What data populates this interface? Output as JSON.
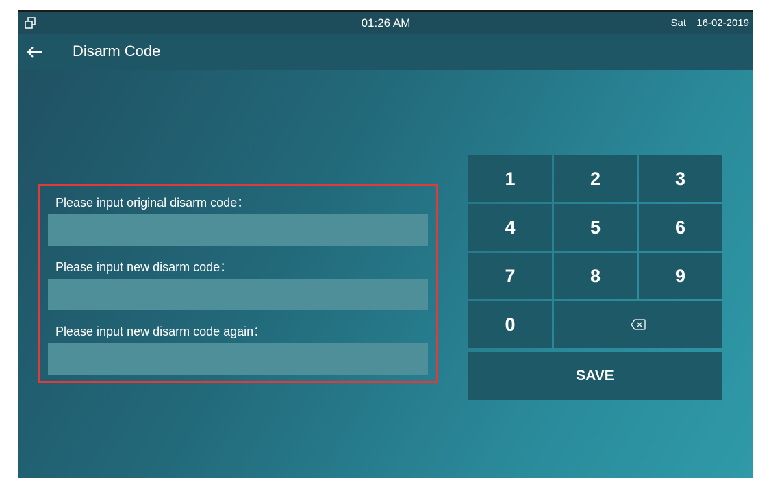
{
  "status_bar": {
    "time": "01:26 AM",
    "day": "Sat",
    "date": "16-02-2019",
    "left_icon": "multi-window-icon"
  },
  "header": {
    "back_icon": "back-arrow-icon",
    "title": "Disarm Code"
  },
  "form": {
    "original_label": "Please input original disarm code：",
    "original_value": "",
    "new_label": "Please input new disarm code：",
    "new_value": "",
    "confirm_label": "Please input new disarm code again：",
    "confirm_value": ""
  },
  "keypad": {
    "keys": [
      "1",
      "2",
      "3",
      "4",
      "5",
      "6",
      "7",
      "8",
      "9",
      "0"
    ],
    "backspace_icon": "backspace-icon",
    "save_label": "SAVE"
  },
  "colors": {
    "highlight_border": "#e03a3a",
    "key_background": "#1d5966",
    "input_background": "#4f8f99"
  }
}
